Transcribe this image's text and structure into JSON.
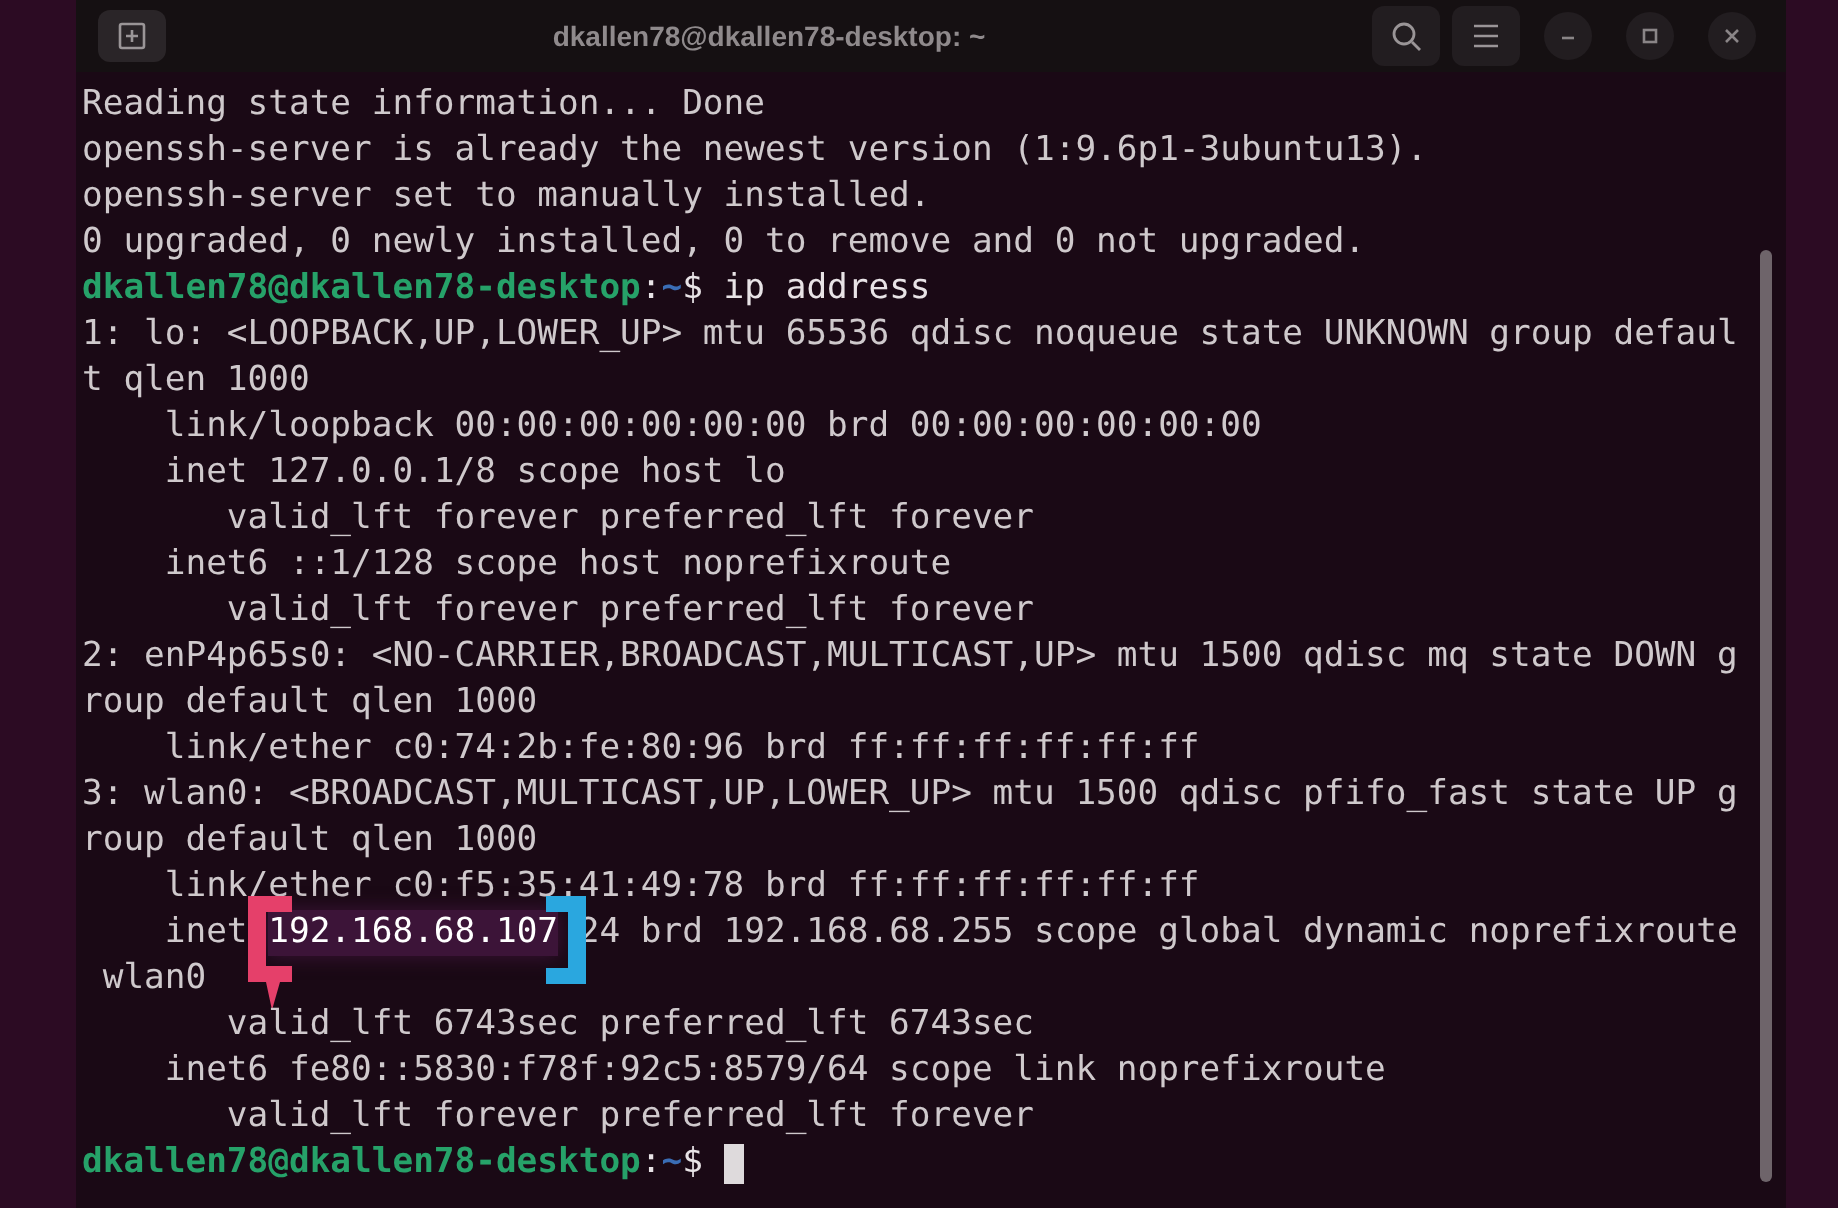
{
  "window": {
    "title": "dkallen78@dkallen78-desktop: ~"
  },
  "terminal": {
    "lines": [
      {
        "kind": "output",
        "text": "Reading state information... Done"
      },
      {
        "kind": "output",
        "text": "openssh-server is already the newest version (1:9.6p1-3ubuntu13)."
      },
      {
        "kind": "output",
        "text": "openssh-server set to manually installed."
      },
      {
        "kind": "output",
        "text": "0 upgraded, 0 newly installed, 0 to remove and 0 not upgraded."
      },
      {
        "kind": "prompt",
        "host": "dkallen78@dkallen78-desktop",
        "colon": ":",
        "path": "~",
        "command": "$ ip address",
        "cursor": false
      },
      {
        "kind": "output",
        "text": "1: lo: <LOOPBACK,UP,LOWER_UP> mtu 65536 qdisc noqueue state UNKNOWN group defaul"
      },
      {
        "kind": "output",
        "text": "t qlen 1000"
      },
      {
        "kind": "output",
        "text": "    link/loopback 00:00:00:00:00:00 brd 00:00:00:00:00:00"
      },
      {
        "kind": "output",
        "text": "    inet 127.0.0.1/8 scope host lo"
      },
      {
        "kind": "output",
        "text": "       valid_lft forever preferred_lft forever"
      },
      {
        "kind": "output",
        "text": "    inet6 ::1/128 scope host noprefixroute"
      },
      {
        "kind": "output",
        "text": "       valid_lft forever preferred_lft forever"
      },
      {
        "kind": "output",
        "text": "2: enP4p65s0: <NO-CARRIER,BROADCAST,MULTICAST,UP> mtu 1500 qdisc mq state DOWN g"
      },
      {
        "kind": "output",
        "text": "roup default qlen 1000"
      },
      {
        "kind": "output",
        "text": "    link/ether c0:74:2b:fe:80:96 brd ff:ff:ff:ff:ff:ff"
      },
      {
        "kind": "output",
        "text": "3: wlan0: <BROADCAST,MULTICAST,UP,LOWER_UP> mtu 1500 qdisc pfifo_fast state UP g"
      },
      {
        "kind": "output",
        "text": "roup default qlen 1000"
      },
      {
        "kind": "output",
        "text": "    link/ether c0:f5:35:41:49:78 brd ff:ff:ff:ff:ff:ff"
      },
      {
        "kind": "highlight",
        "before": "    inet",
        "highlight": "192.168.68.107",
        "after": "24 brd 192.168.68.255 scope global dynamic noprefixroute"
      },
      {
        "kind": "output",
        "text": " wlan0"
      },
      {
        "kind": "output",
        "text": "       valid_lft 6743sec preferred_lft 6743sec"
      },
      {
        "kind": "output",
        "text": "    inet6 fe80::5830:f78f:92c5:8579/64 scope link noprefixroute"
      },
      {
        "kind": "output",
        "text": "       valid_lft forever preferred_lft forever"
      },
      {
        "kind": "prompt",
        "host": "dkallen78@dkallen78-desktop",
        "colon": ":",
        "path": "~",
        "command": "$ ",
        "cursor": true
      }
    ]
  }
}
